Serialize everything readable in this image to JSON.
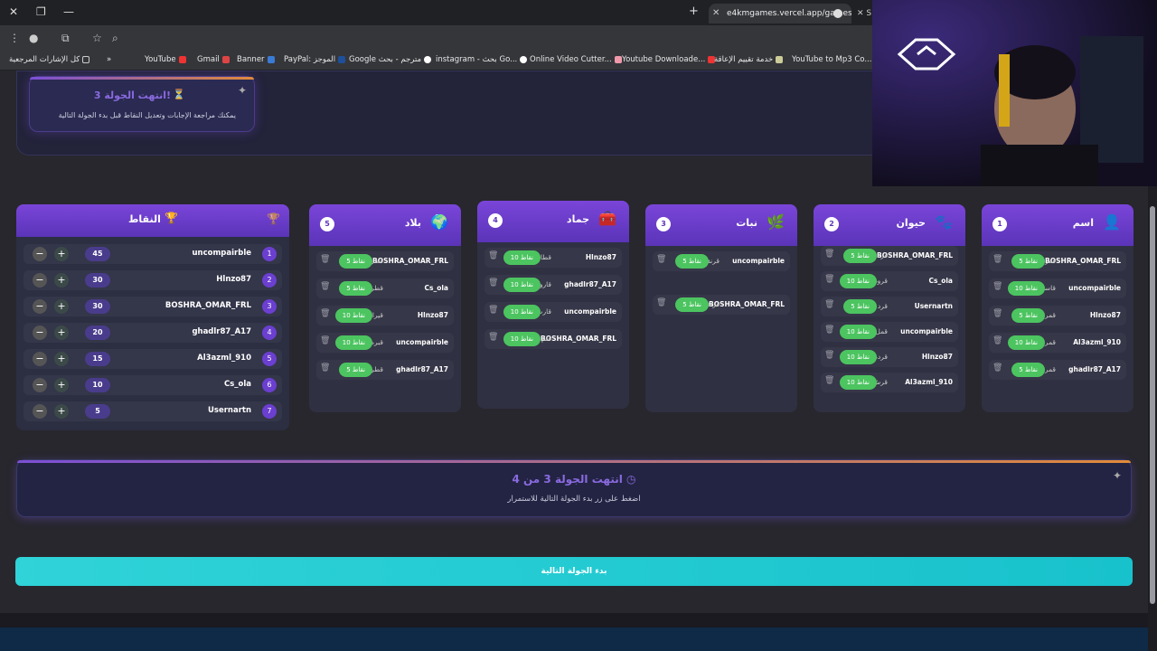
{
  "browser": {
    "tab_title": "e4kmgames.vercel.app/games/",
    "tab2": "S",
    "bookmarks_label": "كل الإشارات المرجعية",
    "bookmarks": [
      "YouTube",
      "Gmail",
      "Banner",
      "PayPal: الموجز",
      "Google مترجم - بحث",
      "instagram - بحث Go...",
      "Online Video Cutter...",
      "Youtube Downloade...",
      "خدمة تقييم الإعاقة",
      "YouTube to Mp3 Co..."
    ]
  },
  "ended_card": {
    "title": "انتهت الجولة 3!",
    "hourglass": "⏳",
    "subtitle": "يمكنك مراجعة الإجابات وتعديل النقاط قبل بدء الجولة التالية"
  },
  "scores": {
    "title": "النقاط",
    "rows": [
      {
        "rank": "1",
        "name": "uncompairble",
        "points": "45"
      },
      {
        "rank": "2",
        "name": "Hlnzo87",
        "points": "30"
      },
      {
        "rank": "3",
        "name": "BOSHRA_OMAR_FRL",
        "points": "30"
      },
      {
        "rank": "4",
        "name": "ghadlr87_A17",
        "points": "20"
      },
      {
        "rank": "5",
        "name": "Al3azml_910",
        "points": "15"
      },
      {
        "rank": "6",
        "name": "Cs_ola",
        "points": "10"
      },
      {
        "rank": "7",
        "name": "Usernartn",
        "points": "5"
      }
    ]
  },
  "columns": [
    {
      "num": "5",
      "title": "بلاد",
      "emoji": "🌍",
      "answers": [
        {
          "name": "BOSHRA_OMAR_FRL",
          "word": "قطر",
          "pill": "5 نقاط"
        },
        {
          "name": "Cs_ola",
          "word": "قطر",
          "pill": "5 نقاط"
        },
        {
          "name": "Hlnzo87",
          "word": "قيران",
          "pill": "10 نقاط"
        },
        {
          "name": "uncompairble",
          "word": "قبرص",
          "pill": "10 نقاط"
        },
        {
          "name": "ghadlr87_A17",
          "word": "قطر",
          "pill": "5 نقاط"
        }
      ]
    },
    {
      "num": "4",
      "title": "جماد",
      "emoji": "🧰",
      "answers": [
        {
          "name": "Hlnzo87",
          "word": "قطار",
          "pill": "10 نقاط"
        },
        {
          "name": "ghadlr87_A17",
          "word": "قارورة",
          "pill": "10 نقاط"
        },
        {
          "name": "uncompairble",
          "word": "قارب",
          "pill": "10 نقاط"
        },
        {
          "name": "BOSHRA_OMAR_FRL",
          "word": "قلم",
          "pill": "10 نقاط"
        }
      ]
    },
    {
      "num": "3",
      "title": "نبات",
      "emoji": "🌿",
      "answers": [
        {
          "name": "uncompairble",
          "word": "قرنفل",
          "pill": "5 نقاط"
        },
        {
          "name": "BOSHRA_OMAR_FRL",
          "word": "قرنفل",
          "pill": "5 نقاط"
        }
      ]
    },
    {
      "num": "2",
      "title": "حيوان",
      "emoji": "🐾",
      "answers": [
        {
          "name": "BOSHRA_OMAR_FRL",
          "word": "قرد",
          "pill": "5 نقاط"
        },
        {
          "name": "Cs_ola",
          "word": "قرود",
          "pill": "10 نقاط"
        },
        {
          "name": "Usernartn",
          "word": "قرد",
          "pill": "5 نقاط"
        },
        {
          "name": "uncompairble",
          "word": "قمل",
          "pill": "10 نقاط"
        },
        {
          "name": "Hlnzo87",
          "word": "قردة",
          "pill": "10 نقاط"
        },
        {
          "name": "Al3azml_910",
          "word": "قرش",
          "pill": "10 نقاط"
        }
      ]
    },
    {
      "num": "1",
      "title": "اسم",
      "emoji": "👤",
      "answers": [
        {
          "name": "BOSHRA_OMAR_FRL",
          "word": "قمر",
          "pill": "5 نقاط"
        },
        {
          "name": "uncompairble",
          "word": "قاسم",
          "pill": "10 نقاط"
        },
        {
          "name": "Hlnzo87",
          "word": "قمر",
          "pill": "5 نقاط"
        },
        {
          "name": "Al3azml_910",
          "word": "قمره",
          "pill": "10 نقاط"
        },
        {
          "name": "ghadlr87_A17",
          "word": "قمر",
          "pill": "5 نقاط"
        }
      ]
    }
  ],
  "round_box": {
    "title": "انتهت الجولة 3 من 4",
    "subtitle": "اضغط على زر بدء الجولة التالية للاستمرار"
  },
  "next_button": "بدء الجولة التالية",
  "colors": {
    "accent": "#7a45d9",
    "pill": "#4cc460",
    "button": "#2fd3d8"
  }
}
